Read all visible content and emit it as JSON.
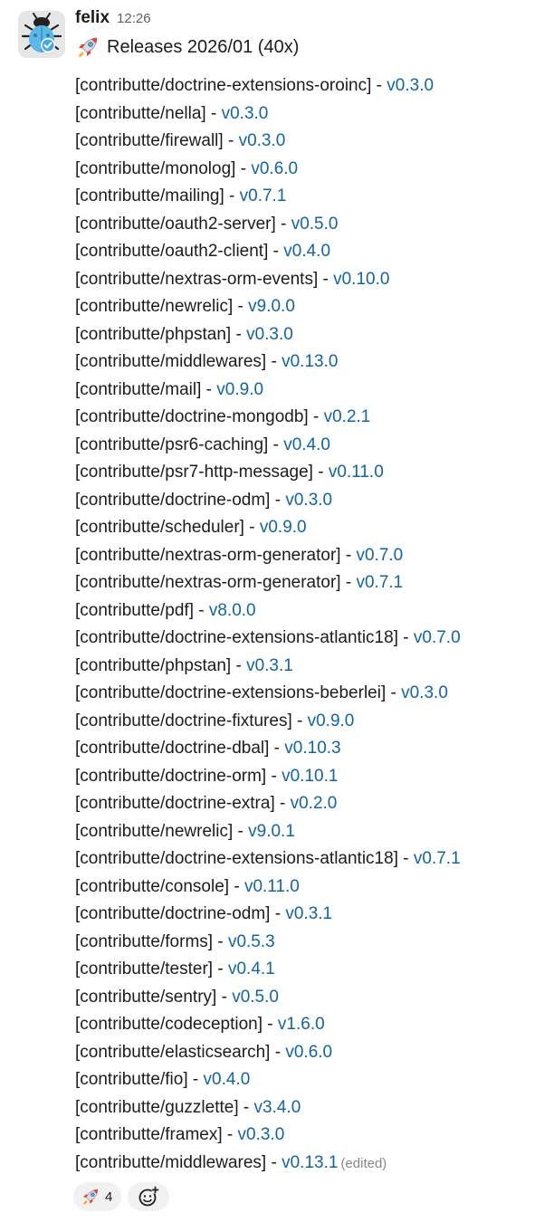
{
  "message": {
    "author": "felix",
    "timestamp": "12:26",
    "title": "Releases 2026/01 (40x)",
    "title_icon": "rocket-icon",
    "separator": " - ",
    "edited_label": "(edited)",
    "releases": [
      {
        "repo": "[contributte/doctrine-extensions-oroinc]",
        "version": "v0.3.0"
      },
      {
        "repo": "[contributte/nella]",
        "version": "v0.3.0"
      },
      {
        "repo": "[contributte/firewall]",
        "version": "v0.3.0"
      },
      {
        "repo": "[contributte/monolog]",
        "version": "v0.6.0"
      },
      {
        "repo": "[contributte/mailing]",
        "version": "v0.7.1"
      },
      {
        "repo": "[contributte/oauth2-server]",
        "version": "v0.5.0"
      },
      {
        "repo": "[contributte/oauth2-client]",
        "version": "v0.4.0"
      },
      {
        "repo": "[contributte/nextras-orm-events]",
        "version": "v0.10.0"
      },
      {
        "repo": "[contributte/newrelic]",
        "version": "v9.0.0"
      },
      {
        "repo": "[contributte/phpstan]",
        "version": "v0.3.0"
      },
      {
        "repo": "[contributte/middlewares]",
        "version": "v0.13.0"
      },
      {
        "repo": "[contributte/mail]",
        "version": "v0.9.0"
      },
      {
        "repo": "[contributte/doctrine-mongodb]",
        "version": "v0.2.1"
      },
      {
        "repo": "[contributte/psr6-caching]",
        "version": "v0.4.0"
      },
      {
        "repo": "[contributte/psr7-http-message]",
        "version": "v0.11.0"
      },
      {
        "repo": "[contributte/doctrine-odm]",
        "version": "v0.3.0"
      },
      {
        "repo": "[contributte/scheduler]",
        "version": "v0.9.0"
      },
      {
        "repo": "[contributte/nextras-orm-generator]",
        "version": "v0.7.0"
      },
      {
        "repo": "[contributte/nextras-orm-generator]",
        "version": "v0.7.1"
      },
      {
        "repo": "[contributte/pdf]",
        "version": "v8.0.0"
      },
      {
        "repo": "[contributte/doctrine-extensions-atlantic18]",
        "version": "v0.7.0"
      },
      {
        "repo": "[contributte/phpstan]",
        "version": "v0.3.1"
      },
      {
        "repo": "[contributte/doctrine-extensions-beberlei]",
        "version": "v0.3.0"
      },
      {
        "repo": "[contributte/doctrine-fixtures]",
        "version": "v0.9.0"
      },
      {
        "repo": "[contributte/doctrine-dbal]",
        "version": "v0.10.3"
      },
      {
        "repo": "[contributte/doctrine-orm]",
        "version": "v0.10.1"
      },
      {
        "repo": "[contributte/doctrine-extra]",
        "version": "v0.2.0"
      },
      {
        "repo": "[contributte/newrelic]",
        "version": "v9.0.1"
      },
      {
        "repo": "[contributte/doctrine-extensions-atlantic18]",
        "version": "v0.7.1"
      },
      {
        "repo": "[contributte/console]",
        "version": "v0.11.0"
      },
      {
        "repo": "[contributte/doctrine-odm]",
        "version": "v0.3.1"
      },
      {
        "repo": "[contributte/forms]",
        "version": "v0.5.3"
      },
      {
        "repo": "[contributte/tester]",
        "version": "v0.4.1"
      },
      {
        "repo": "[contributte/sentry]",
        "version": "v0.5.0"
      },
      {
        "repo": "[contributte/codeception]",
        "version": "v1.6.0"
      },
      {
        "repo": "[contributte/elasticsearch]",
        "version": "v0.6.0"
      },
      {
        "repo": "[contributte/fio]",
        "version": "v0.4.0"
      },
      {
        "repo": "[contributte/guzzlette]",
        "version": "v3.4.0"
      },
      {
        "repo": "[contributte/framex]",
        "version": "v0.3.0"
      },
      {
        "repo": "[contributte/middlewares]",
        "version": "v0.13.1"
      }
    ]
  },
  "reactions": [
    {
      "emoji": "rocket-icon",
      "count": "4"
    }
  ],
  "add_reaction_icon": "add-reaction-icon",
  "colors": {
    "link": "#1264a3",
    "text": "#1d1c1d",
    "muted": "#616061",
    "reaction_bg": "#f1f1f1"
  }
}
